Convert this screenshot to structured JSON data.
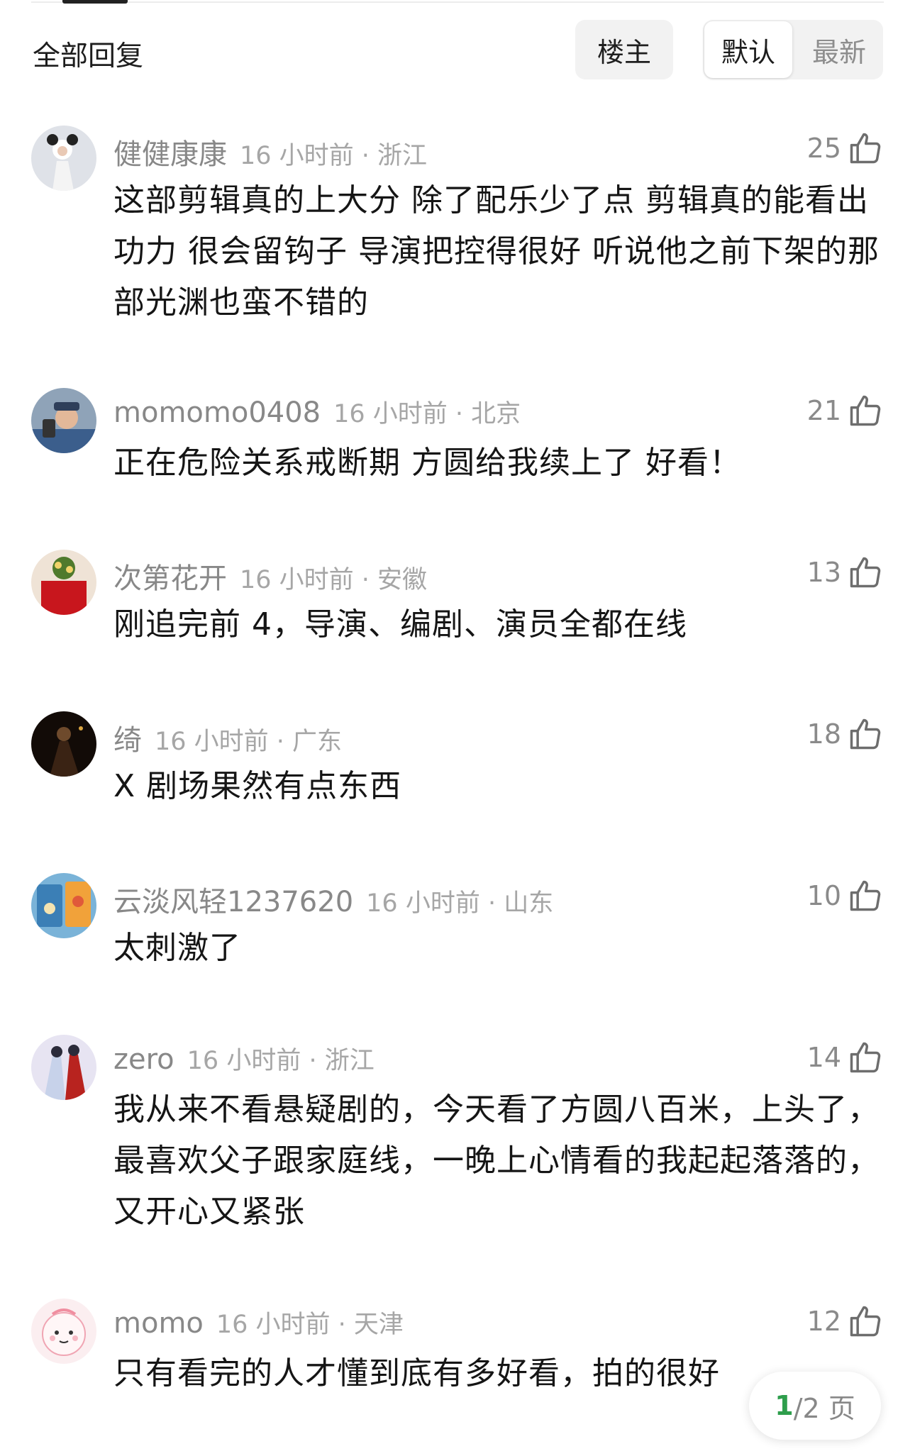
{
  "header": {
    "title": "全部回复",
    "filters": {
      "op": "楼主",
      "default": "默认",
      "latest": "最新"
    },
    "selected_sort": "默认"
  },
  "comments": [
    {
      "username": "健健康康",
      "time_location": "16 小时前 · 浙江",
      "likes": "25",
      "text": "这部剪辑真的上大分 除了配乐少了点 剪辑真的能看出功力 很会留钩子 导演把控得很好 听说他之前下架的那部光渊也蛮不错的"
    },
    {
      "username": "momomo0408",
      "time_location": "16 小时前 · 北京",
      "likes": "21",
      "text": "正在危险关系戒断期 方圆给我续上了 好看！"
    },
    {
      "username": "次第花开",
      "time_location": "16 小时前 · 安徽",
      "likes": "13",
      "text": "刚追完前 4，导演、编剧、演员全都在线"
    },
    {
      "username": "绮",
      "time_location": "16 小时前 · 广东",
      "likes": "18",
      "text": "X 剧场果然有点东西"
    },
    {
      "username": "云淡风轻1237620",
      "time_location": "16 小时前 · 山东",
      "likes": "10",
      "text": "太刺激了"
    },
    {
      "username": "zero",
      "time_location": "16 小时前 · 浙江",
      "likes": "14",
      "text": "我从来不看悬疑剧的，今天看了方圆八百米，上头了，最喜欢父子跟家庭线，一晚上心情看的我起起落落的，又开心又紧张"
    },
    {
      "username": "momo",
      "time_location": "16 小时前 · 天津",
      "likes": "12",
      "text": "只有看完的人才懂到底有多好看，拍的很好"
    }
  ],
  "pagination": {
    "current": "1",
    "rest": "/2 页"
  },
  "colors": {
    "accent_green": "#2e9e4c",
    "meta_gray": "#888888",
    "text_dark": "#151515"
  }
}
